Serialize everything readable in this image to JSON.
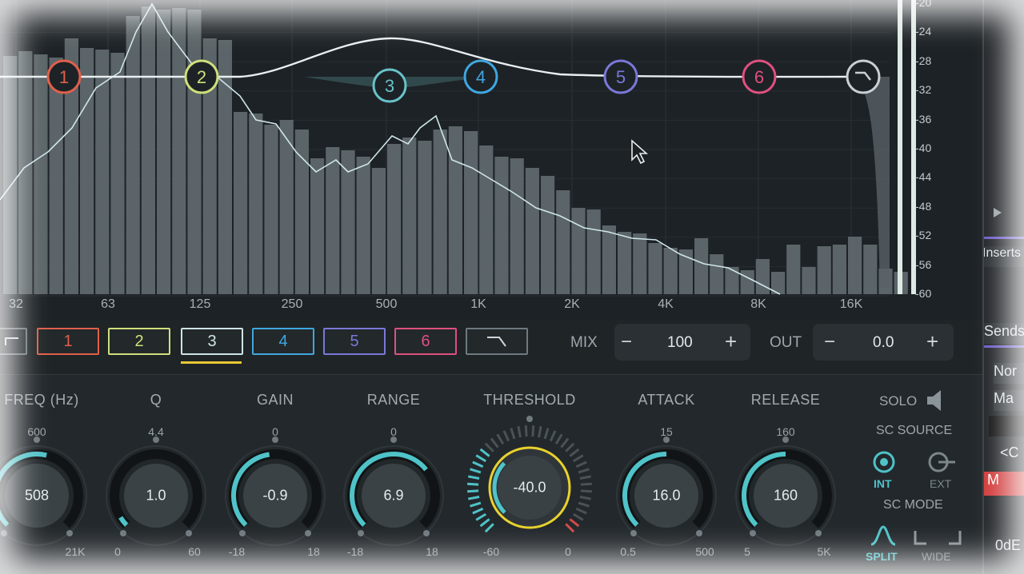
{
  "analyzer": {
    "db_ticks": [
      "-20",
      "-24",
      "-28",
      "-32",
      "-36",
      "-40",
      "-44",
      "-48",
      "-52",
      "-56",
      "-60"
    ],
    "hz_ticks": [
      "32",
      "63",
      "125",
      "250",
      "500",
      "1K",
      "2K",
      "4K",
      "8K",
      "16K"
    ]
  },
  "bands": [
    {
      "label": "1",
      "color": "#e0604a"
    },
    {
      "label": "2",
      "color": "#cfe07a"
    },
    {
      "label": "3",
      "color": "#67c3c9"
    },
    {
      "label": "4",
      "color": "#3fa7e0"
    },
    {
      "label": "5",
      "color": "#7a78d8"
    },
    {
      "label": "6",
      "color": "#e0507f"
    }
  ],
  "selected_band": "3",
  "highcut_icon": "highcut-filter-icon",
  "mix": {
    "label": "MIX",
    "value": "100",
    "minus": "−",
    "plus": "+"
  },
  "out": {
    "label": "OUT",
    "value": "0.0",
    "minus": "−",
    "plus": "+"
  },
  "knobs": [
    {
      "name": "freq",
      "label": "FREQ (Hz)",
      "top": "600",
      "min": "",
      "max": "21K",
      "value": "508",
      "fraction": 0.55
    },
    {
      "name": "q",
      "label": "Q",
      "top": "4.4",
      "min": "0",
      "max": "60",
      "value": "1.0",
      "fraction": 0.05
    },
    {
      "name": "gain",
      "label": "GAIN",
      "top": "0",
      "min": "-18",
      "max": "18",
      "value": "-0.9",
      "fraction": 0.47
    },
    {
      "name": "range",
      "label": "RANGE",
      "top": "0",
      "min": "-18",
      "max": "18",
      "value": "6.9",
      "fraction": 0.69
    },
    {
      "name": "threshold",
      "label": "THRESHOLD",
      "top": "",
      "min": "-60",
      "max": "0",
      "value": "-40.0",
      "fraction": 0.33
    },
    {
      "name": "attack",
      "label": "ATTACK",
      "top": "15",
      "min": "0.5",
      "max": "500",
      "value": "16.0",
      "fraction": 0.5
    },
    {
      "name": "release",
      "label": "RELEASE",
      "top": "160",
      "min": "5",
      "max": "5K",
      "value": "160",
      "fraction": 0.5
    }
  ],
  "solo": {
    "label": "SOLO",
    "icon": "speaker-icon"
  },
  "sc_source": {
    "label": "SC SOURCE",
    "int": "INT",
    "ext": "EXT"
  },
  "sc_mode": {
    "label": "SC MODE",
    "split": "SPLIT",
    "wide": "WIDE"
  },
  "right_panel": {
    "inserts": "Inserts",
    "sends": "Sends",
    "no": "Nor",
    "ma": "Ma",
    "c": "<C",
    "m": "M",
    "db": "0dE"
  },
  "colors": {
    "accent": "#4fc3c8",
    "selected_underline": "#e8c834",
    "threshold_ring": "#e8d22c"
  }
}
